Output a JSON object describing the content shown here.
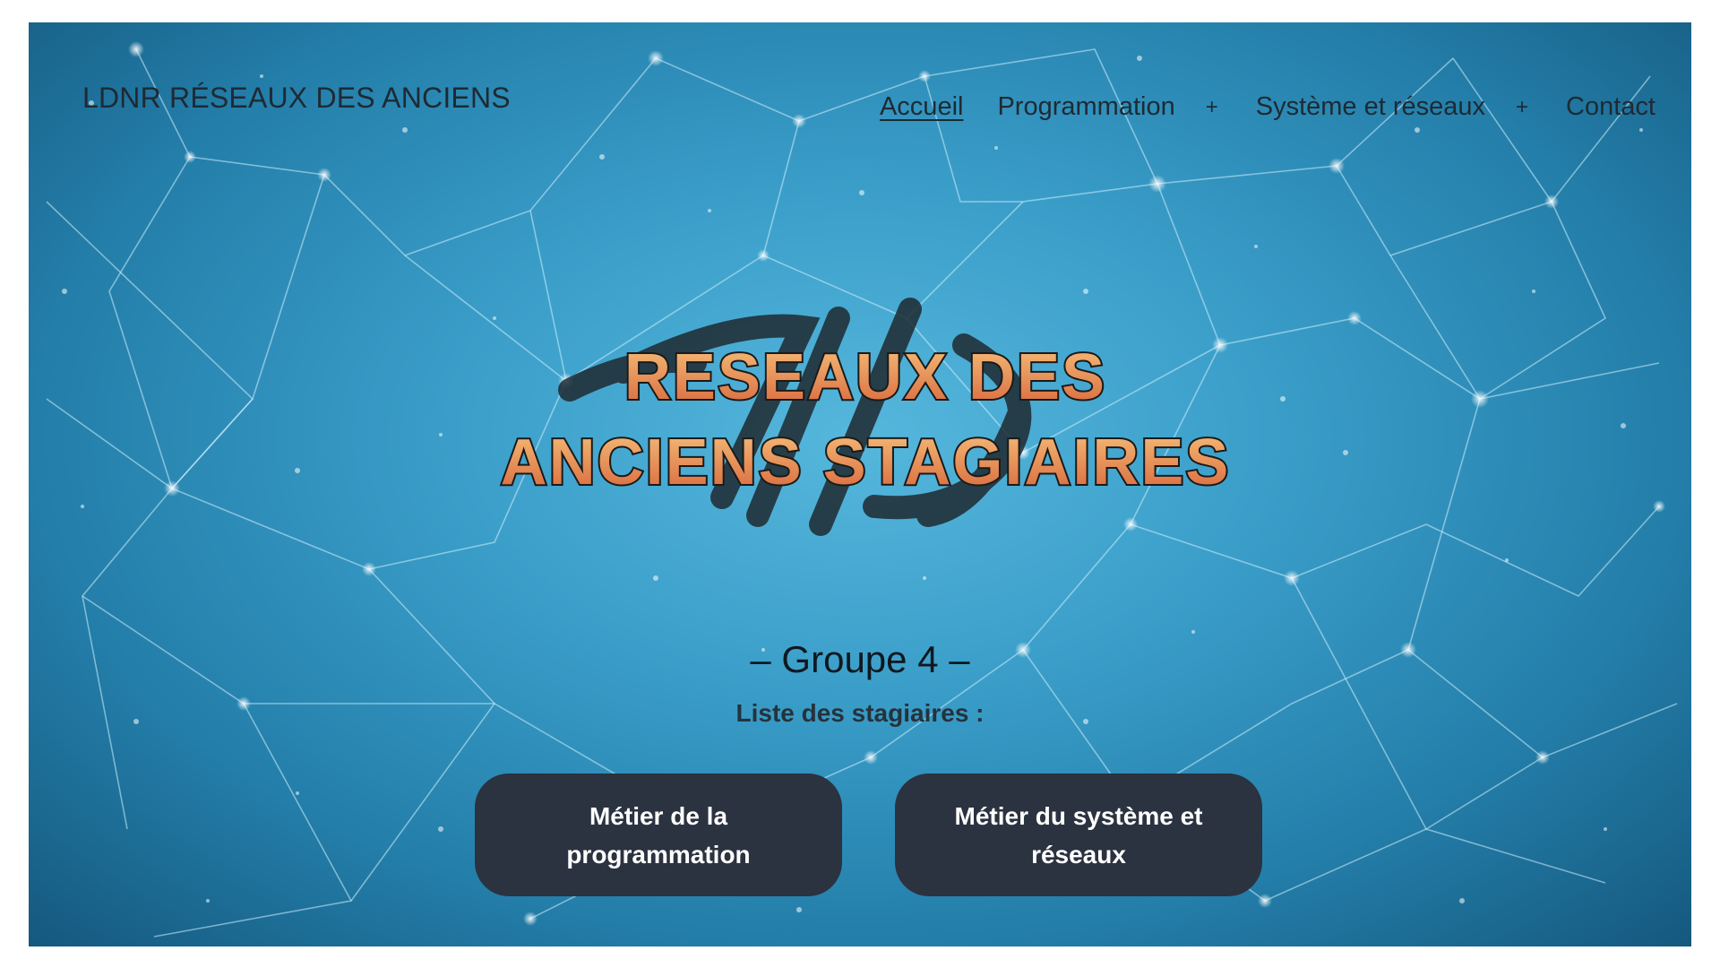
{
  "header": {
    "site_title": "LDNR RÉSEAUX DES ANCIENS"
  },
  "nav": {
    "items": [
      {
        "label": "Accueil",
        "active": true,
        "has_submenu": false
      },
      {
        "label": "Programmation",
        "active": false,
        "has_submenu": true
      },
      {
        "label": "Système et réseaux",
        "active": false,
        "has_submenu": true
      },
      {
        "label": "Contact",
        "active": false,
        "has_submenu": false
      }
    ],
    "submenu_symbol": "+"
  },
  "logo": {
    "line1": "RESEAUX DES",
    "line2": "ANCIENS STAGIAIRES",
    "icon": "network-logo-icon"
  },
  "main": {
    "group_title": "– Groupe 4 –",
    "list_label": "Liste des stagiaires :",
    "buttons": [
      {
        "label": "Métier de la programmation"
      },
      {
        "label": "Métier du système et réseaux"
      }
    ]
  },
  "colors": {
    "background_center": "#56b7dc",
    "background_edge": "#15587e",
    "button_bg": "#2b3240",
    "button_text": "#ffffff",
    "nav_text": "#1e2a33",
    "logo_gradient_top": "#f6c07a",
    "logo_gradient_bottom": "#d7643a"
  }
}
